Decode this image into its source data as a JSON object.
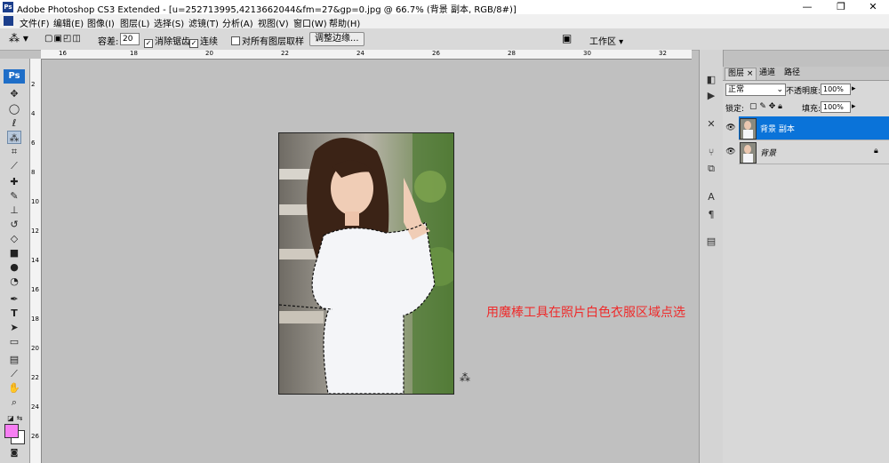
{
  "window": {
    "title": "Adobe Photoshop CS3 Extended - [u=252713995,4213662044&fm=27&gp=0.jpg @ 66.7% (背景 副本, RGB/8#)]",
    "app_icon": "Ps",
    "minimize": "—",
    "maximize": "❐",
    "close": "✕"
  },
  "menu": [
    "文件(F)",
    "编辑(E)",
    "图像(I)",
    "图层(L)",
    "选择(S)",
    "滤镜(T)",
    "分析(A)",
    "视图(V)",
    "窗口(W)",
    "帮助(H)"
  ],
  "options": {
    "tolerance_label": "容差:",
    "tolerance_value": "20",
    "antialias_label": "消除锯齿",
    "contiguous_label": "连续",
    "all_layers_label": "对所有图层取样",
    "refine_edge_label": "调整边缘...",
    "workspace_label": "工作区 ▾"
  },
  "ruler_top": [
    "16",
    "18",
    "20",
    "22",
    "24",
    "26",
    "28",
    "30",
    "32"
  ],
  "ruler_left": [
    "2",
    "4",
    "6",
    "8",
    "10",
    "12",
    "14",
    "16",
    "18",
    "20",
    "22",
    "24",
    "26"
  ],
  "toolbox": {
    "logo": "Ps",
    "tools": [
      "move-icon",
      "marquee-icon",
      "lasso-icon",
      "magic-wand-icon",
      "crop-icon",
      "slice-icon",
      "healing-icon",
      "brush-icon",
      "clone-stamp-icon",
      "history-brush-icon",
      "eraser-icon",
      "gradient-icon",
      "blur-icon",
      "dodge-icon",
      "pen-icon",
      "type-icon",
      "path-select-icon",
      "shape-icon",
      "notes-icon",
      "eyedropper-icon",
      "hand-icon",
      "zoom-icon"
    ],
    "foreground_color": "#f77ef3",
    "background_color": "#ffffff"
  },
  "canvas": {
    "caption": "用魔棒工具在照片白色衣服区域点选"
  },
  "layers_panel": {
    "tabs": [
      "图层 ×",
      "通道",
      "路径"
    ],
    "blend_mode": "正常",
    "opacity_label": "不透明度:",
    "opacity_value": "100%",
    "lock_label": "锁定:",
    "fill_label": "填充:",
    "fill_value": "100%",
    "layers": [
      {
        "name": "背景 副本",
        "selected": true
      },
      {
        "name": "背景",
        "selected": false
      }
    ]
  },
  "colors": {
    "accent": "#0a73d9",
    "caption": "#ee2b2b",
    "canvas_bg": "#c0c0c0"
  }
}
